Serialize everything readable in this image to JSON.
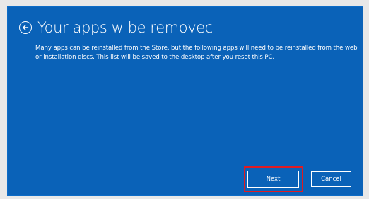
{
  "dialog": {
    "title": "Your apps w  be removec",
    "message": "Many apps can be reinstalled from the Store, but the following apps will need to be reinstalled from the web or installation discs. This list will be saved to the desktop after you reset this PC."
  },
  "buttons": {
    "next_label": "Next",
    "cancel_label": "Cancel"
  },
  "colors": {
    "panel_bg": "#0a62b8",
    "highlight": "#e01b22",
    "text": "#ffffff"
  },
  "icons": {
    "back": "back-arrow-icon"
  }
}
